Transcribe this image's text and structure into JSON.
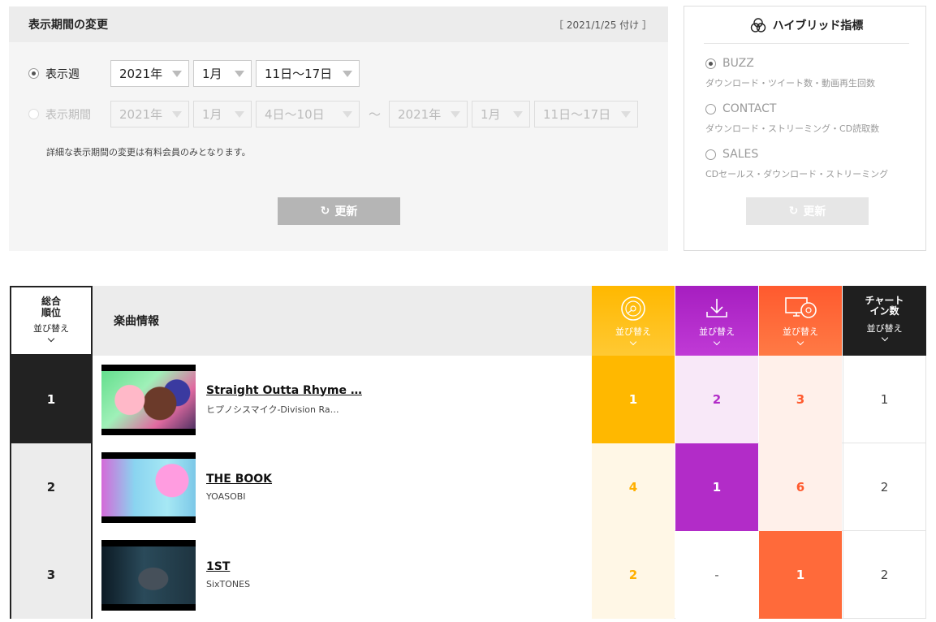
{
  "period": {
    "title": "表示期間の変更",
    "date_note": "［ 2021/1/25 付け ］",
    "week_label": "表示週",
    "week": {
      "year": "2021年",
      "month": "1月",
      "range": "11日〜17日"
    },
    "range_label": "表示期間",
    "range_from": {
      "year": "2021年",
      "month": "1月",
      "range": "4日〜10日"
    },
    "range_sep": "〜",
    "range_to": {
      "year": "2021年",
      "month": "1月",
      "range": "11日〜17日"
    },
    "note": "詳細な表示期間の変更は有料会員のみとなります。",
    "update_label": "更新"
  },
  "hybrid": {
    "title": "ハイブリッド指標",
    "options": [
      {
        "label": "BUZZ",
        "desc": "ダウンロード・ツイート数・動画再生回数",
        "selected": true
      },
      {
        "label": "CONTACT",
        "desc": "ダウンロード・ストリーミング・CD読取数",
        "selected": false
      },
      {
        "label": "SALES",
        "desc": "CDセールス・ダウンロード・ストリーミング",
        "selected": false
      }
    ],
    "update_label": "更新"
  },
  "table": {
    "header": {
      "rank_line1": "総合",
      "rank_line2": "順位",
      "sort": "並び替え",
      "info": "楽曲情報",
      "chartin_line1": "チャート",
      "chartin_line2": "イン数"
    },
    "rows": [
      {
        "rank": "1",
        "title": "Straight Outta Rhyme …",
        "artist": "ヒプノシスマイク-Division Ra…",
        "buzz": "1",
        "download": "2",
        "streaming": "3",
        "chartin": "1"
      },
      {
        "rank": "2",
        "title": "THE BOOK",
        "artist": "YOASOBI",
        "buzz": "4",
        "download": "1",
        "streaming": "6",
        "chartin": "2"
      },
      {
        "rank": "3",
        "title": "1ST",
        "artist": "SixTONES",
        "buzz": "2",
        "download": "-",
        "streaming": "1",
        "chartin": "2"
      }
    ]
  },
  "colors": {
    "buzz": "#ffb800",
    "download": "#b22cc8",
    "streaming": "#ff6a3a",
    "chartin": "#1f1f1f"
  },
  "icons": {
    "update": "refresh-icon",
    "hybrid": "venn-icon",
    "buzz": "disc-icon",
    "download": "download-icon",
    "streaming": "monitor-disc-icon"
  }
}
